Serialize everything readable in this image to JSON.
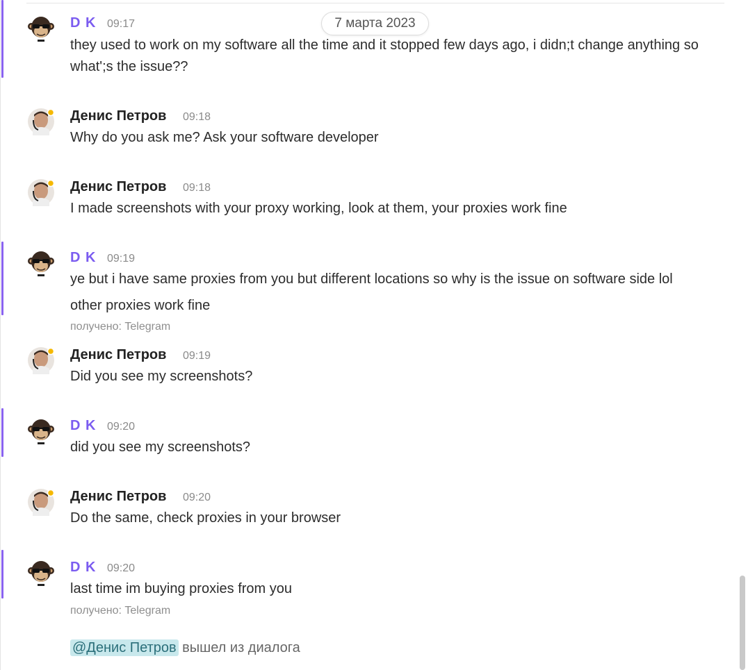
{
  "date_separator": "7 марта 2023",
  "colors": {
    "accent": "#8a63f0",
    "name_dk": "#7b5cf0",
    "mention_bg": "#c8e8ec",
    "status_dot": "#f5b800"
  },
  "messages": [
    {
      "author": "D K",
      "time": "09:17",
      "text": "they used to work on my software all the time and it stopped few days ago, i didn;t change anything so what';s the issue??",
      "avatar": "monkey-avatar-icon"
    },
    {
      "author": "Денис Петров",
      "time": "09:18",
      "text": "Why do you ask me? Ask your software developer",
      "avatar": "agent-avatar-icon"
    },
    {
      "author": "Денис Петров",
      "time": "09:18",
      "text": "I made screenshots with your proxy working, look at them, your proxies work fine",
      "avatar": "agent-avatar-icon"
    },
    {
      "author": "D K",
      "time": "09:19",
      "text": "ye but i have same proxies from you but different locations so why is the issue on software side lol",
      "text2": "other proxies work fine",
      "via": "получено: Telegram",
      "avatar": "monkey-avatar-icon"
    },
    {
      "author": "Денис Петров",
      "time": "09:19",
      "text": "Did you see my screenshots?",
      "avatar": "agent-avatar-icon"
    },
    {
      "author": "D K",
      "time": "09:20",
      "text": "did you see my screenshots?",
      "avatar": "monkey-avatar-icon"
    },
    {
      "author": "Денис Петров",
      "time": "09:20",
      "text": "Do the same, check proxies in your browser",
      "avatar": "agent-avatar-icon"
    },
    {
      "author": "D K",
      "time": "09:20",
      "text": "last time im buying proxies from you",
      "via": "получено: Telegram",
      "avatar": "monkey-avatar-icon"
    }
  ],
  "system": {
    "mention": "@Денис Петров",
    "text": " вышел из диалога"
  }
}
